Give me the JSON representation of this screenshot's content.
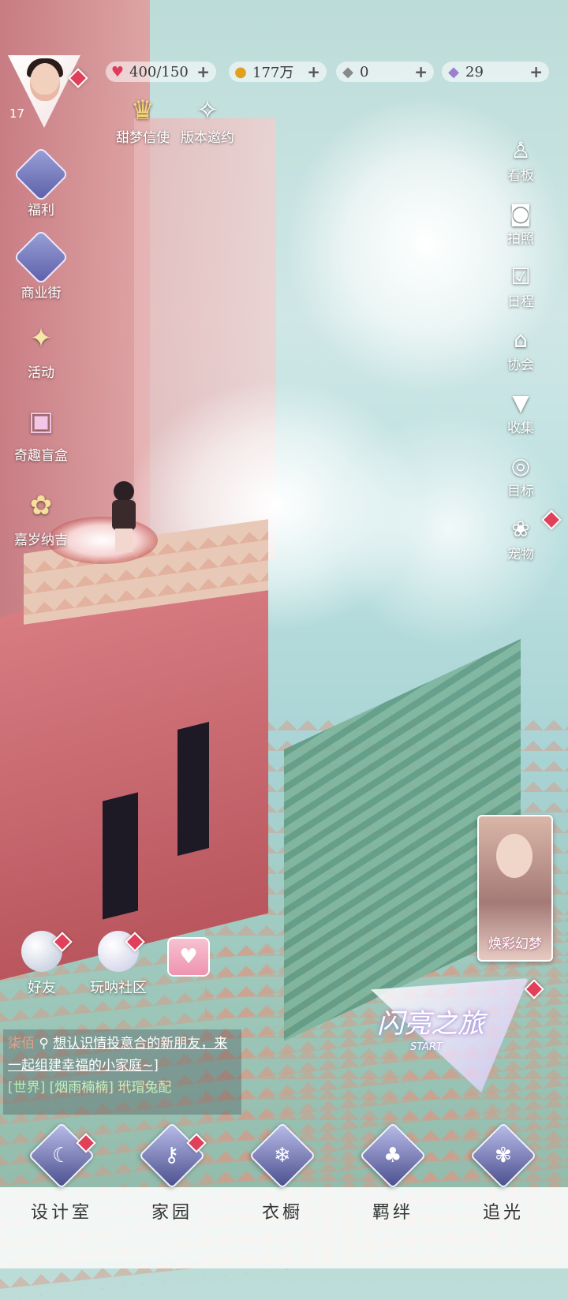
{
  "player": {
    "level": "17"
  },
  "resources": [
    {
      "name": "stamina",
      "icon": "heart-gem-icon",
      "value": "400/150"
    },
    {
      "name": "gold",
      "icon": "gold-coin-icon",
      "value": "177万"
    },
    {
      "name": "crystal",
      "icon": "crystal-icon",
      "value": "0"
    },
    {
      "name": "diamond",
      "icon": "diamond-icon",
      "value": "29"
    }
  ],
  "top_events": [
    {
      "label": "甜梦信使",
      "icon": "crown-icon"
    },
    {
      "label": "版本邀约",
      "icon": "swan-icon"
    }
  ],
  "left_menu": [
    {
      "label": "福利",
      "icon": "balloon-icon"
    },
    {
      "label": "商业街",
      "icon": "shopping-bag-icon"
    },
    {
      "label": "活动",
      "icon": "stars-icon"
    },
    {
      "label": "奇趣盲盒",
      "icon": "mystery-box-icon"
    },
    {
      "label": "嘉岁纳吉",
      "icon": "fortune-icon"
    }
  ],
  "right_menu": [
    {
      "label": "看板",
      "icon": "board-icon"
    },
    {
      "label": "拍照",
      "icon": "camera-icon"
    },
    {
      "label": "日程",
      "icon": "calendar-icon"
    },
    {
      "label": "协会",
      "icon": "guild-icon"
    },
    {
      "label": "收集",
      "icon": "collection-icon"
    },
    {
      "label": "目标",
      "icon": "target-icon"
    },
    {
      "label": "宠物",
      "icon": "paw-icon"
    }
  ],
  "social": [
    {
      "label": "好友",
      "icon": "friends-icon"
    },
    {
      "label": "玩呐社区",
      "icon": "community-icon"
    },
    {
      "label": "",
      "icon": "gift-icon"
    }
  ],
  "chat": {
    "name": "柒佰",
    "message": "想认识情投意合的新朋友，来一起组建幸福的小家庭~]",
    "channel": "[世界]",
    "world_sender": "[烟雨楠楠]",
    "world_message": "玳瑁兔配"
  },
  "promo": {
    "label": "焕彩幻梦"
  },
  "event_banner": {
    "title": "闪亮之旅",
    "subtitle": "START"
  },
  "bottom_nav": [
    {
      "label": "设计室",
      "icon": "moon-icon"
    },
    {
      "label": "家园",
      "icon": "key-icon"
    },
    {
      "label": "衣橱",
      "icon": "snowflake-icon"
    },
    {
      "label": "羁绊",
      "icon": "clover-icon"
    },
    {
      "label": "追光",
      "icon": "butterfly-icon"
    }
  ]
}
